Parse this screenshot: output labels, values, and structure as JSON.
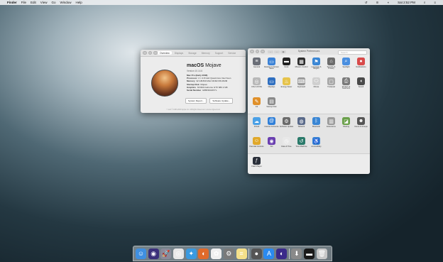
{
  "menubar": {
    "apple": "",
    "app_name": "Finder",
    "items": [
      "File",
      "Edit",
      "View",
      "Go",
      "Window",
      "Help"
    ],
    "clock": "Sat 2:52 PM"
  },
  "about_window": {
    "tabs": [
      "Overview",
      "Displays",
      "Storage",
      "Memory",
      "Support",
      "Service"
    ],
    "title_bold": "macOS",
    "title_rest": "Mojave",
    "version": "Version 10.14.6",
    "model": "Mac Pro (Early 2008)",
    "specs": [
      {
        "key": "Processor",
        "value": "2 × 2.8 GHz Quad-Core Intel Xeon"
      },
      {
        "key": "Memory",
        "value": "32 GB 800 MHz DDR2 FB-DIMM"
      },
      {
        "key": "Startup Disk",
        "value": "Mojave"
      },
      {
        "key": "Graphics",
        "value": "NVIDIA GeForce GTX 680 2 GB"
      },
      {
        "key": "Serial Number",
        "value": "G88039ADXYL"
      }
    ],
    "buttons": [
      "System Report...",
      "Software Update..."
    ],
    "footer": "™ and © 1983-2020 Apple Inc. All Rights Reserved. License Agreement"
  },
  "prefs_window": {
    "title": "System Preferences",
    "search_placeholder": "Search",
    "section1": [
      {
        "label": "General",
        "icon": "general-icon",
        "color": "#6b6f78",
        "glyph": "≡"
      },
      {
        "label": "Desktop & Screen Saver",
        "icon": "desktop-icon",
        "color": "#3b82d6",
        "glyph": "▭"
      },
      {
        "label": "Dock",
        "icon": "dock-icon",
        "color": "#222222",
        "glyph": "▬"
      },
      {
        "label": "Mission Control",
        "icon": "mission-control-icon",
        "color": "#2f2f2f",
        "glyph": "▦"
      },
      {
        "label": "Language & Region",
        "icon": "language-icon",
        "color": "#3a86d4",
        "glyph": "⚑"
      },
      {
        "label": "Security & Privacy",
        "icon": "security-icon",
        "color": "#6c6c6c",
        "glyph": "⌂"
      },
      {
        "label": "Spotlight",
        "icon": "spotlight-icon",
        "color": "#4a8fe0",
        "glyph": "⌕"
      },
      {
        "label": "Notifications",
        "icon": "notifications-icon",
        "color": "#d84a4a",
        "glyph": "●"
      },
      {
        "label": "CDs & DVDs",
        "icon": "cds-icon",
        "color": "#b8b8b8",
        "glyph": "◎"
      },
      {
        "label": "Displays",
        "icon": "displays-icon",
        "color": "#2f6fc0",
        "glyph": "▭"
      },
      {
        "label": "Energy Saver",
        "icon": "energy-icon",
        "color": "#e6c34a",
        "glyph": "♨"
      },
      {
        "label": "Keyboard",
        "icon": "keyboard-icon",
        "color": "#9a9a9a",
        "glyph": "⌨"
      },
      {
        "label": "Mouse",
        "icon": "mouse-icon",
        "color": "#cfcfcf",
        "glyph": "⬭"
      },
      {
        "label": "Trackpad",
        "icon": "trackpad-icon",
        "color": "#a8a8a8",
        "glyph": "▢"
      },
      {
        "label": "Printers & Scanners",
        "icon": "printer-icon",
        "color": "#7a7a7a",
        "glyph": "⎙"
      },
      {
        "label": "Sound",
        "icon": "sound-icon",
        "color": "#4a4a4a",
        "glyph": "◖"
      },
      {
        "label": "Ink",
        "icon": "ink-icon",
        "color": "#e0902a",
        "glyph": "✎"
      },
      {
        "label": "Startup Disk",
        "icon": "startup-disk-icon",
        "color": "#8a8a8a",
        "glyph": "▤"
      }
    ],
    "section2": [
      {
        "label": "iCloud",
        "icon": "icloud-icon",
        "color": "#4aa0e6",
        "glyph": "☁"
      },
      {
        "label": "Internet Accounts",
        "icon": "internet-accounts-icon",
        "color": "#2f7fd8",
        "glyph": "@"
      },
      {
        "label": "Software Update",
        "icon": "software-update-icon",
        "color": "#6b6b6b",
        "glyph": "⚙"
      },
      {
        "label": "Network",
        "icon": "network-icon",
        "color": "#5a6a8a",
        "glyph": "◍"
      },
      {
        "label": "Bluetooth",
        "icon": "bluetooth-icon",
        "color": "#3a86d4",
        "glyph": "ᛒ"
      },
      {
        "label": "Extensions",
        "icon": "extensions-icon",
        "color": "#9a9a9a",
        "glyph": "▥"
      },
      {
        "label": "Sharing",
        "icon": "sharing-icon",
        "color": "#6aa04a",
        "glyph": "◪"
      },
      {
        "label": "Users & Groups",
        "icon": "users-icon",
        "color": "#555555",
        "glyph": "☻"
      },
      {
        "label": "Parental Controls",
        "icon": "parental-controls-icon",
        "color": "#e0a82a",
        "glyph": "☺"
      },
      {
        "label": "Siri",
        "icon": "siri-icon",
        "color": "#6a3fb0",
        "glyph": "◉"
      },
      {
        "label": "Date & Time",
        "icon": "date-time-icon",
        "color": "#e8e8e8",
        "glyph": "◷"
      },
      {
        "label": "Time Machine",
        "icon": "time-machine-icon",
        "color": "#2a7a6a",
        "glyph": "↺"
      },
      {
        "label": "Accessibility",
        "icon": "accessibility-icon",
        "color": "#3a86d4",
        "glyph": "♿"
      }
    ],
    "section3": [
      {
        "label": "Flash Player",
        "icon": "flash-player-icon",
        "color": "#2a2f3a",
        "glyph": "ƒ"
      }
    ]
  },
  "dock": [
    {
      "name": "finder-dock-icon",
      "color": "#3f8fe0",
      "glyph": "☺"
    },
    {
      "name": "siri-dock-icon",
      "color": "#3a2f7a",
      "glyph": "◉"
    },
    {
      "name": "launchpad-dock-icon",
      "color": "#8a8a9a",
      "glyph": "🚀"
    },
    {
      "name": "chrome-dock-icon",
      "color": "#e8e8e8",
      "glyph": "◎"
    },
    {
      "name": "safari-dock-icon",
      "color": "#3a9ae0",
      "glyph": "✦"
    },
    {
      "name": "firefox-dock-icon",
      "color": "#e06a2a",
      "glyph": "◐"
    },
    {
      "name": "photos-dock-icon",
      "color": "#f0f0f0",
      "glyph": "✿"
    },
    {
      "name": "system-preferences-dock-icon",
      "color": "#7a7a7a",
      "glyph": "⚙"
    },
    {
      "name": "notes-dock-icon",
      "color": "#f5e08a",
      "glyph": "≡"
    },
    {
      "name": "sep1",
      "color": "",
      "glyph": ""
    },
    {
      "name": "disk-utility-dock-icon",
      "color": "#555555",
      "glyph": "●"
    },
    {
      "name": "app-store-dock-icon",
      "color": "#2a8af0",
      "glyph": "A"
    },
    {
      "name": "firefox-nightly-dock-icon",
      "color": "#3a2a8a",
      "glyph": "◐"
    },
    {
      "name": "sep2",
      "color": "",
      "glyph": ""
    },
    {
      "name": "downloads-dock-icon",
      "color": "#8a8a8a",
      "glyph": "⬇"
    },
    {
      "name": "terminal-dock-icon",
      "color": "#1a1a1a",
      "glyph": "▬"
    },
    {
      "name": "trash-dock-icon",
      "color": "#c8c8c8",
      "glyph": "🗑"
    }
  ]
}
